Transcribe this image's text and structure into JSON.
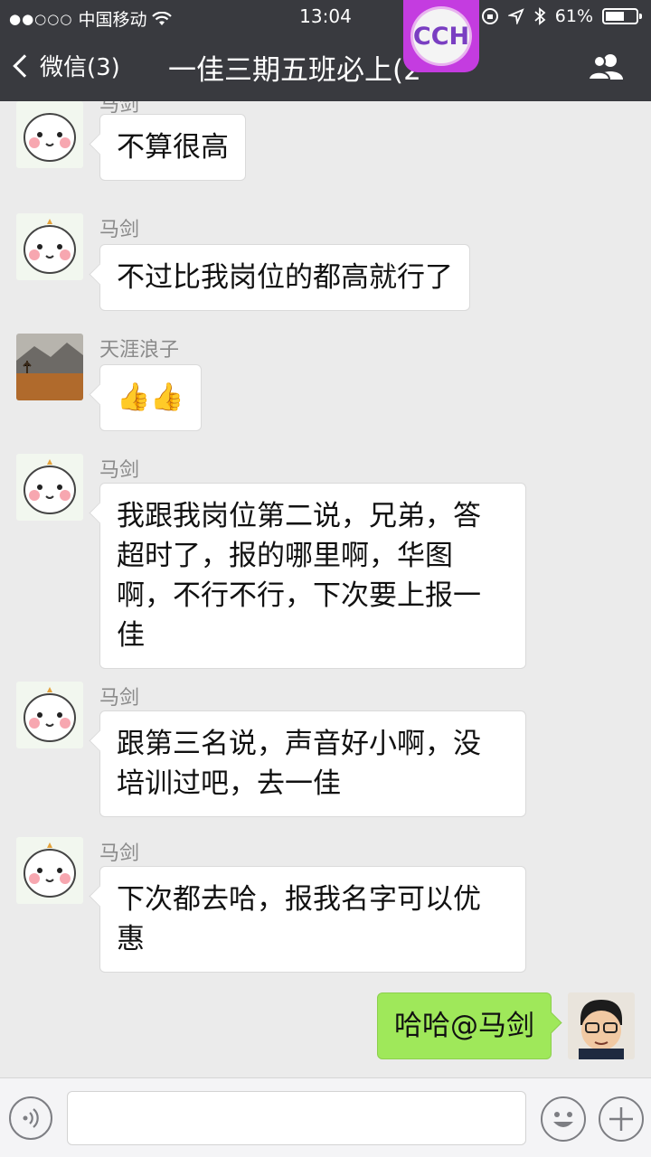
{
  "status_bar": {
    "signal": "●●○○○",
    "carrier": "中国移动",
    "time": "13:04",
    "battery_percent": "61%",
    "battery_level": 0.61
  },
  "nav": {
    "back_label": "微信(3)",
    "title": "一佳三期五班必上(2",
    "overlay_badge": "CCH"
  },
  "messages": [
    {
      "sender": "马剑",
      "text": "不算很高",
      "avatar": "pig-sticker",
      "side": "left"
    },
    {
      "sender": "马剑",
      "text": "不过比我岗位的都高就行了",
      "avatar": "pig-sticker",
      "side": "left"
    },
    {
      "sender": "天涯浪子",
      "text": "👍👍",
      "avatar": "landscape-photo",
      "side": "left"
    },
    {
      "sender": "马剑",
      "lines": [
        "我跟我岗位第二说，兄弟，答",
        "超时了，报的哪里啊，华图",
        "啊，不行不行，下次要上报一",
        "佳"
      ],
      "avatar": "pig-sticker",
      "side": "left"
    },
    {
      "sender": "马剑",
      "lines": [
        "跟第三名说，声音好小啊，没",
        "培训过吧，去一佳"
      ],
      "avatar": "pig-sticker",
      "side": "left"
    },
    {
      "sender": "马剑",
      "lines": [
        "下次都去哈，报我名字可以优",
        "惠"
      ],
      "avatar": "pig-sticker",
      "side": "left"
    },
    {
      "text": "哈哈@马剑",
      "avatar": "cartoon-glasses-man",
      "side": "right"
    }
  ],
  "input_bar": {
    "placeholder": "",
    "icons": [
      "voice-icon",
      "emoji-icon",
      "plus-icon"
    ]
  },
  "colors": {
    "nav_bg": "#393a3f",
    "chat_bg": "#ebebeb",
    "my_bubble": "#9fe85a",
    "their_bubble": "#ffffff",
    "badge": "#c43ce0"
  }
}
